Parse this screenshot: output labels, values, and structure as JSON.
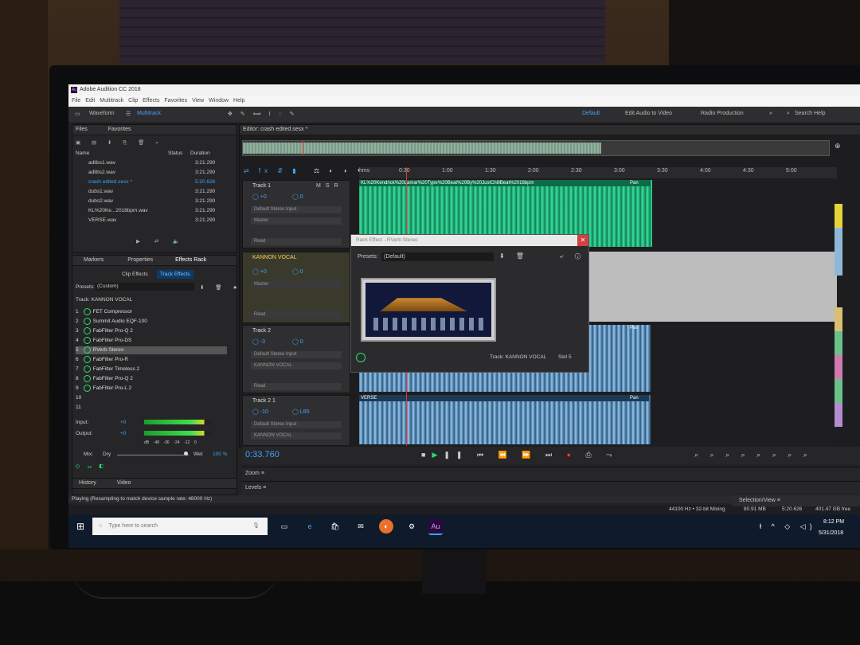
{
  "window": {
    "title": "Adobe Audition CC 2018",
    "app_icon": "Au"
  },
  "menu": [
    "File",
    "Edit",
    "Multitrack",
    "Clip",
    "Effects",
    "Favorites",
    "View",
    "Window",
    "Help"
  ],
  "toolbar": {
    "waveform": "Waveform",
    "multitrack": "Multitrack",
    "workspaces": [
      "Default",
      "Edit Audio to Video",
      "Radio Production"
    ],
    "search": "Search Help"
  },
  "files_panel": {
    "tabs": [
      "Files",
      "Favorites"
    ],
    "columns": [
      "Name",
      "Status",
      "Duration"
    ],
    "files": [
      {
        "name": "adlibs1.wav",
        "duration": "3:21.290"
      },
      {
        "name": "adlibs2.wav",
        "duration": "3:21.290"
      },
      {
        "name": "crash edited.sesx *",
        "duration": "5:20.626"
      },
      {
        "name": "dubs1.wav",
        "duration": "3:21.290"
      },
      {
        "name": "dubs2.wav",
        "duration": "3:21.290"
      },
      {
        "name": "KL%20Ke...2018bpm.wav",
        "duration": "3:21.290"
      },
      {
        "name": "VERSE.wav",
        "duration": "3:21.290"
      }
    ]
  },
  "effects_panel": {
    "tabs": [
      "Markers",
      "Properties",
      "Effects Rack"
    ],
    "subtabs": [
      "Clip Effects",
      "Track Effects"
    ],
    "presets_label": "Presets:",
    "presets_value": "(Custom)",
    "track_label": "Track: KANNON VOCAL",
    "effects": [
      {
        "n": "1",
        "name": "FET Compressor"
      },
      {
        "n": "2",
        "name": "Summit Audio EQF-100"
      },
      {
        "n": "3",
        "name": "FabFilter Pro-Q 2"
      },
      {
        "n": "4",
        "name": "FabFilter Pro-DS"
      },
      {
        "n": "5",
        "name": "RVerb Stereo"
      },
      {
        "n": "6",
        "name": "FabFilter Pro-R"
      },
      {
        "n": "7",
        "name": "FabFilter Timeless 2"
      },
      {
        "n": "8",
        "name": "FabFilter Pro-Q 2"
      },
      {
        "n": "9",
        "name": "FabFilter Pro-L 2"
      },
      {
        "n": "10",
        "name": ""
      },
      {
        "n": "11",
        "name": ""
      }
    ],
    "input_label": "Input:",
    "input_value": "+0",
    "output_label": "Output:",
    "output_value": "+0",
    "db_scale": [
      "dB",
      "-48",
      "-36",
      "-24",
      "-12",
      "0"
    ],
    "mix_label": "Mix:",
    "mix_dry": "Dry",
    "mix_wet": "Wet",
    "mix_percent": "100 %",
    "mix_level": 1.0
  },
  "history_panel": {
    "tabs": [
      "History",
      "Video"
    ]
  },
  "editor": {
    "title": "Editor: crash edited.sesx *",
    "ruler": [
      "hms",
      "0:30",
      "1:00",
      "1:30",
      "2:00",
      "2:30",
      "3:00",
      "3:30",
      "4:00",
      "4:30",
      "5:00"
    ],
    "time": "0:33.760",
    "tracks": [
      {
        "name": "Track 1",
        "vol": "+0",
        "pan": "0",
        "input": "Default Stereo Input",
        "output": "Master",
        "mode": "Read",
        "clip": "KL%20Kendrick%20Lamar%20Type%20Beat%20By%20JustChillBeat%2018bpm",
        "clip_label": "Pan"
      },
      {
        "name": "KANNON VOCAL",
        "vol": "+0",
        "pan": "0",
        "output": "Master",
        "mode": "Read"
      },
      {
        "name": "Track 2",
        "vol": "-3",
        "pan": "0",
        "input": "Default Stereo Input",
        "output": "KANNON VOCAL",
        "mode": "Read",
        "clip_label": "Pan"
      },
      {
        "name": "Track 2 1",
        "vol": "-10",
        "pan": "L85",
        "input": "Default Stereo Input",
        "output": "KANNON VOCAL",
        "clip": "VERSE",
        "clip_label": "Pan"
      }
    ],
    "letter_markers": [
      "M",
      "S",
      "R"
    ]
  },
  "dialog": {
    "title": "Rack Effect - RVerb Stereo",
    "presets_label": "Presets:",
    "presets_value": "(Default)",
    "track": "Track: KANNON VOCAL",
    "slot": "Slot 5"
  },
  "bottom_panels": {
    "zoom": "Zoom",
    "levels": "Levels",
    "selection": "Selection/View"
  },
  "status": {
    "message": "Playing (Resampling to match device sample rate: 48000 Hz)",
    "sample_rate": "44100 Hz • 32-bit Mixing",
    "memory": "80.91 MB",
    "duration": "5:20.626",
    "disk": "401.47 GB free"
  },
  "taskbar": {
    "search_placeholder": "Type here to search",
    "time": "8:12 PM",
    "date": "5/31/2018",
    "apps": [
      "Task View",
      "Edge",
      "Store",
      "Mail",
      "Firefox",
      "Settings",
      "Au"
    ]
  },
  "colors": {
    "accent": "#3fa2ff",
    "green_wave": "#3fe0a0",
    "blue_wave": "#9cc6e8",
    "playhead": "#e53535"
  }
}
